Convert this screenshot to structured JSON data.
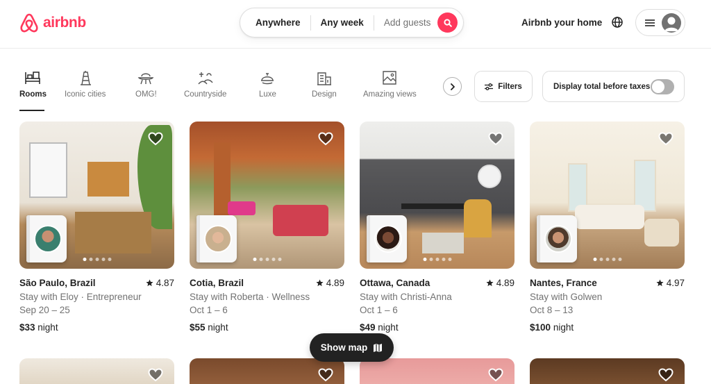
{
  "header": {
    "logo_text": "airbnb",
    "search": {
      "where": "Anywhere",
      "when": "Any week",
      "guests": "Add guests"
    },
    "host_link": "Airbnb your home"
  },
  "categories": [
    {
      "label": "Rooms",
      "icon": "bed-icon",
      "active": true
    },
    {
      "label": "Iconic cities",
      "icon": "tower-icon"
    },
    {
      "label": "OMG!",
      "icon": "ufo-house-icon"
    },
    {
      "label": "Countryside",
      "icon": "countryside-icon"
    },
    {
      "label": "Luxe",
      "icon": "luxe-bell-icon"
    },
    {
      "label": "Design",
      "icon": "design-building-icon"
    },
    {
      "label": "Amazing views",
      "icon": "picture-frame-icon"
    }
  ],
  "filters_label": "Filters",
  "display_total_label": "Display total before taxes",
  "listings": [
    {
      "title": "São Paulo, Brazil",
      "rating": "4.87",
      "host": "Stay with Eloy · Entrepreneur",
      "dates": "Sep 20 – 25",
      "price": "$33",
      "price_unit": "night"
    },
    {
      "title": "Cotia, Brazil",
      "rating": "4.89",
      "host": "Stay with Roberta · Wellness",
      "dates": "Oct 1 – 6",
      "price": "$55",
      "price_unit": "night"
    },
    {
      "title": "Ottawa, Canada",
      "rating": "4.89",
      "host": "Stay with Christi-Anna",
      "dates": "Oct 1 – 6",
      "price": "$49",
      "price_unit": "night"
    },
    {
      "title": "Nantes, France",
      "rating": "4.97",
      "host": "Stay with Golwen",
      "dates": "Oct 8 – 13",
      "price": "$100",
      "price_unit": "night"
    }
  ],
  "show_map_label": "Show map",
  "colors": {
    "brand": "#ff385c",
    "text": "#222222",
    "muted": "#717171"
  }
}
